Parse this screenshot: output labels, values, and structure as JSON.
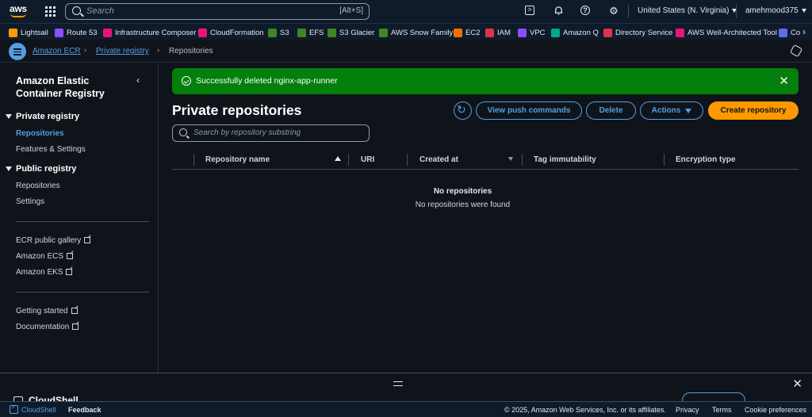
{
  "topnav": {
    "logo": "aws",
    "search_placeholder": "Search",
    "search_shortcut": "[Alt+S]",
    "region": "United States (N. Virginia)",
    "user": "amehmood375",
    "icons": [
      "services-grid-icon",
      "cloudshell-icon",
      "notifications-icon",
      "help-icon",
      "settings-icon"
    ]
  },
  "favorites": [
    {
      "label": "Lightsail",
      "color": "#ff9900"
    },
    {
      "label": "Route 53",
      "color": "#8c4fff"
    },
    {
      "label": "Infrastructure Composer",
      "color": "#e7157b"
    },
    {
      "label": "CloudFormation",
      "color": "#e7157b"
    },
    {
      "label": "S3",
      "color": "#3f8624"
    },
    {
      "label": "EFS",
      "color": "#3f8624"
    },
    {
      "label": "S3 Glacier",
      "color": "#3f8624"
    },
    {
      "label": "AWS Snow Family",
      "color": "#3f8624"
    },
    {
      "label": "EC2",
      "color": "#ed7100"
    },
    {
      "label": "IAM",
      "color": "#dd344c"
    },
    {
      "label": "VPC",
      "color": "#8c4fff"
    },
    {
      "label": "Amazon Q",
      "color": "#01a88d"
    },
    {
      "label": "Directory Service",
      "color": "#dd344c"
    },
    {
      "label": "AWS Well-Architected Tool",
      "color": "#e7157b"
    },
    {
      "label": "Co",
      "color": "#5a6cf3"
    }
  ],
  "breadcrumbs": {
    "items": [
      "Amazon ECR",
      "Private registry"
    ],
    "current": "Repositories"
  },
  "sidebar": {
    "title": "Amazon Elastic Container Registry",
    "private_section": "Private registry",
    "private_items": [
      "Repositories",
      "Features & Settings"
    ],
    "public_section": "Public registry",
    "public_items": [
      "Repositories",
      "Settings"
    ],
    "links": [
      "ECR public gallery",
      "Amazon ECS",
      "Amazon EKS"
    ],
    "help_links": [
      "Getting started",
      "Documentation"
    ]
  },
  "flash": {
    "message": "Successfully deleted nginx-app-runner",
    "type": "success",
    "color": "#037f0c"
  },
  "main": {
    "title": "Private repositories",
    "buttons": {
      "view_push": "View push commands",
      "delete": "Delete",
      "actions": "Actions",
      "create": "Create repository"
    },
    "filter_placeholder": "Search by repository substring",
    "columns": [
      "Repository name",
      "URI",
      "Created at",
      "Tag immutability",
      "Encryption type"
    ],
    "empty_title": "No repositories",
    "empty_message": "No repositories were found"
  },
  "cloudshell_panel": {
    "title": "CloudShell"
  },
  "footer": {
    "cloudshell": "CloudShell",
    "feedback": "Feedback",
    "copyright": "© 2025, Amazon Web Services, Inc. or its affiliates.",
    "privacy": "Privacy",
    "terms": "Terms",
    "cookies": "Cookie preferences"
  },
  "colors": {
    "accent": "#539fe5",
    "primary_button": "#ff9900",
    "background": "#0f141a",
    "nav": "#0f1b2a"
  }
}
